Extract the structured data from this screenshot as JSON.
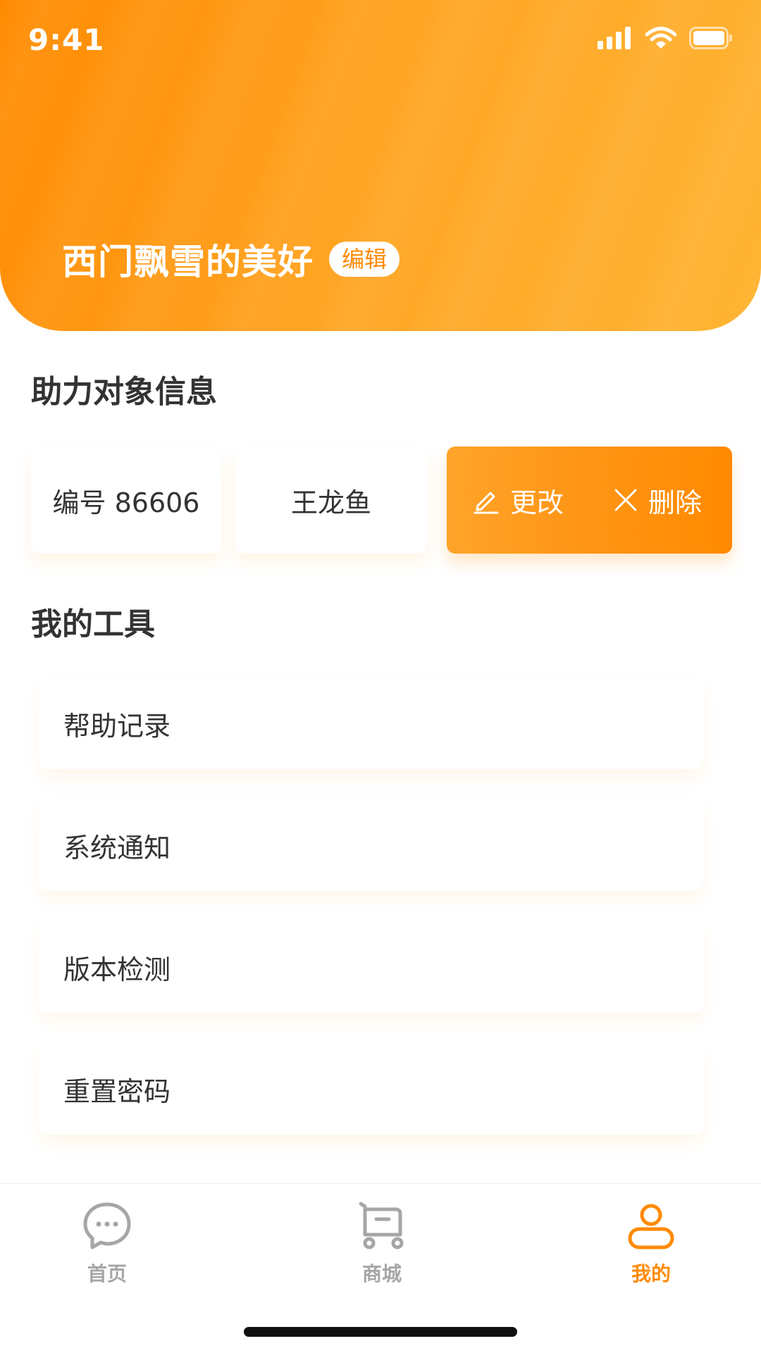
{
  "status_bar": {
    "time": "9:41"
  },
  "profile": {
    "name": "西门飘雪的美好",
    "edit_label": "编辑"
  },
  "helper_section": {
    "title": "助力对象信息",
    "id_text": "编号 86606",
    "name": "王龙鱼",
    "change_label": "更改",
    "delete_label": "删除"
  },
  "tools_section": {
    "title": "我的工具",
    "items": [
      {
        "label": "帮助记录"
      },
      {
        "label": "系统通知"
      },
      {
        "label": "版本检测"
      },
      {
        "label": "重置密码"
      }
    ]
  },
  "tab_bar": {
    "active": "我的",
    "accent_color": "#ff8a00",
    "inactive_color": "#a6a6a6",
    "items": [
      {
        "label": "首页",
        "icon": "chat-bubble-icon"
      },
      {
        "label": "商城",
        "icon": "cart-icon"
      },
      {
        "label": "我的",
        "icon": "user-icon"
      }
    ]
  }
}
